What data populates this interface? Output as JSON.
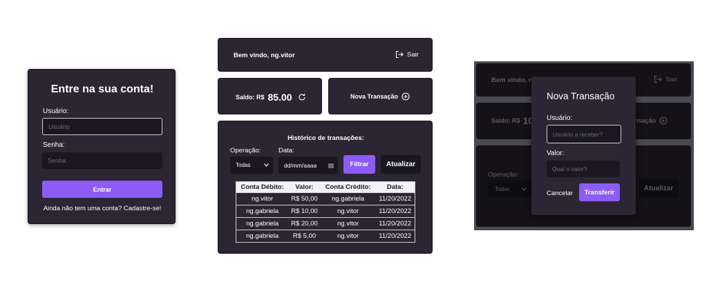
{
  "login": {
    "title": "Entre na sua conta!",
    "user_label": "Usuário:",
    "user_placeholder": "Usuário",
    "pass_label": "Senha:",
    "pass_placeholder": "Senha",
    "submit_label": "Entrar",
    "signup_text": "Ainda não tem uma conta? Cadastre-se!"
  },
  "dashboard": {
    "welcome": "Bem vindo, ng.vitor",
    "logout_label": "Sair",
    "balance_label": "Saldo: R$",
    "balance_value": "85.00",
    "new_tx_label": "Nova Transação",
    "history_title": "Histórico de transações:",
    "operation_label": "Operação:",
    "operation_selected": "Todas",
    "date_label": "Data:",
    "date_placeholder": "dd/mm/aaaa",
    "filter_label": "Filtrar",
    "refresh_label": "Atualizar",
    "table": {
      "headers": [
        "Conta Débito:",
        "Valor:",
        "Conta Crédito:",
        "Data:"
      ],
      "rows": [
        [
          "ng.vitor",
          "R$ 50,00",
          "ng.gabriela",
          "11/20/2022"
        ],
        [
          "ng.gabriela",
          "R$ 10,00",
          "ng.vitor",
          "11/20/2022"
        ],
        [
          "ng.gabriela",
          "R$ 20,00",
          "ng.vitor",
          "11/20/2022"
        ],
        [
          "ng.gabriela",
          "R$ 5,00",
          "ng.vitor",
          "11/20/2022"
        ]
      ]
    }
  },
  "modal_view": {
    "bg_welcome": "Bem vindo, ng",
    "bg_logout": "Sair",
    "bg_balance_label": "Saldo: R$",
    "bg_balance_value": "10",
    "bg_new_tx_fragment": "nsação",
    "bg_operation_label": "Operação:",
    "bg_operation_selected": "Todas",
    "bg_refresh": "Atualizar",
    "modal": {
      "title": "Nova Transação",
      "user_label": "Usuário:",
      "user_placeholder": "Usuário a receber?",
      "value_label": "Valor:",
      "value_placeholder": "Qual o valor?",
      "cancel_label": "Cancelar",
      "transfer_label": "Transferir"
    }
  },
  "colors": {
    "card_bg": "#2b2534",
    "input_bg": "#1a1720",
    "accent": "#8b5cf6",
    "text": "#ffffff"
  },
  "icons": {
    "logout": "logout-icon",
    "refresh": "refresh-icon",
    "add": "plus-circle-icon",
    "calendar": "calendar-icon",
    "select_arrow": "chevron-down-icon"
  }
}
